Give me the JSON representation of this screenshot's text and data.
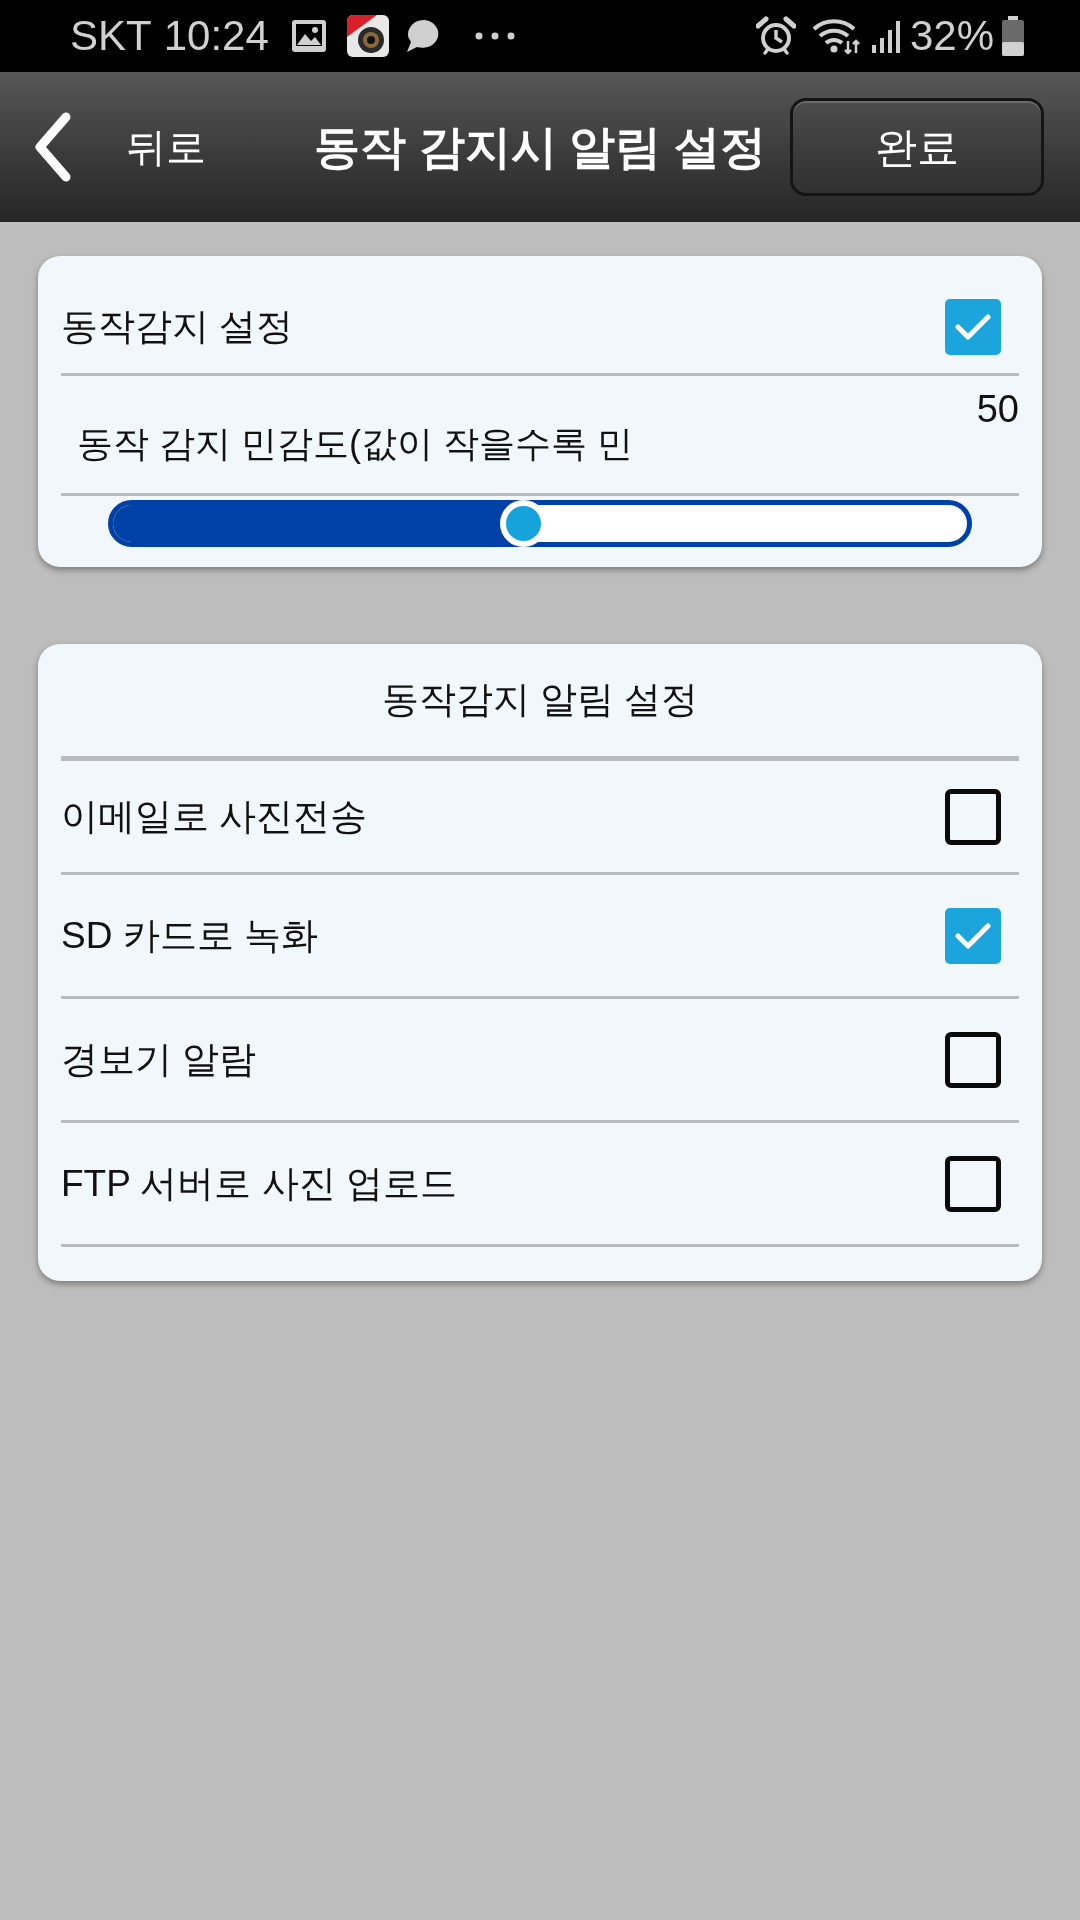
{
  "status_bar": {
    "carrier": "SKT",
    "time": "10:24",
    "battery": "32%"
  },
  "header": {
    "back": "뒤로",
    "title": "동작 감지시 알림 설정",
    "done": "완료"
  },
  "motion_card": {
    "detection": {
      "label": "동작감지 설정",
      "checked": true
    },
    "sensitivity": {
      "reading": "50",
      "label": "동작 감지 민감도(값이 작을수록 민",
      "level": 0.47
    }
  },
  "alert_card": {
    "title": "동작감지 알림 설정",
    "options": [
      {
        "label": "이메일로 사진전송",
        "checked": false
      },
      {
        "label": "SD 카드로 녹화",
        "checked": true
      },
      {
        "label": "경보기 알람",
        "checked": false
      },
      {
        "label": "FTP 서버로 사진 업로드",
        "checked": false
      }
    ]
  }
}
